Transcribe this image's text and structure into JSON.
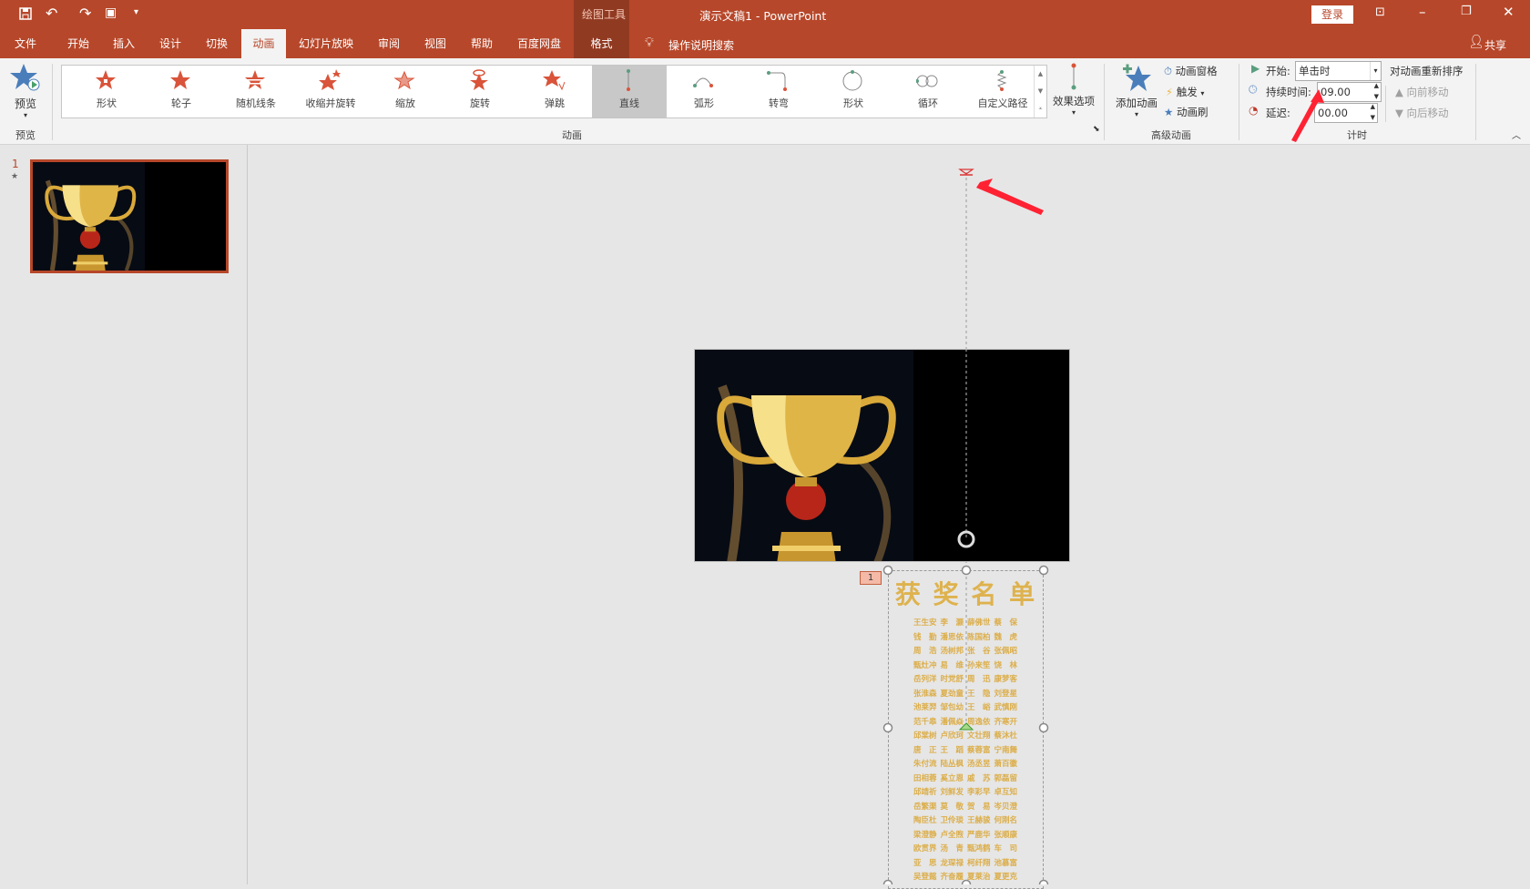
{
  "titlebar": {
    "title": "演示文稿1  -  PowerPoint",
    "context_tab": "绘图工具",
    "login": "登录"
  },
  "tabs": [
    "文件",
    "开始",
    "插入",
    "设计",
    "切换",
    "动画",
    "幻灯片放映",
    "审阅",
    "视图",
    "帮助",
    "百度网盘",
    "格式"
  ],
  "search": "操作说明搜索",
  "share": "共享",
  "ribbon": {
    "preview": "预览",
    "preview_group": "预览",
    "gallery": [
      "形状",
      "轮子",
      "随机线条",
      "收缩并旋转",
      "缩放",
      "旋转",
      "弹跳",
      "直线",
      "弧形",
      "转弯",
      "形状",
      "循环",
      "自定义路径"
    ],
    "anim_group": "动画",
    "effect_options": "效果选项",
    "add_animation": "添加动画",
    "anim_pane": "动画窗格",
    "trigger": "触发",
    "anim_painter": "动画刷",
    "advanced_group": "高级动画",
    "start_label": "开始:",
    "start_value": "单击时",
    "duration_label": "持续时间:",
    "duration_value": "09.00",
    "delay_label": "延迟:",
    "delay_value": "00.00",
    "timing_group": "计时",
    "reorder": "对动画重新排序",
    "move_earlier": "向前移动",
    "move_later": "向后移动"
  },
  "slides": {
    "number": "1",
    "anim_mark": "★"
  },
  "slide": {
    "anim_tag": "1",
    "heading": "获 奖 名 单",
    "names": [
      [
        "王生安",
        "李　灏",
        "薛佛世",
        "蔡　保"
      ],
      [
        "钱　勤",
        "潘思依",
        "陈国柏",
        "魏　虎"
      ],
      [
        "周　浩",
        "汤树邦",
        "张　谷",
        "张佩昭"
      ],
      [
        "甄灶冲",
        "易　维",
        "孙来笙",
        "饶　林"
      ],
      [
        "岳列洋",
        "时党舒",
        "周　迅",
        "康梦客"
      ],
      [
        "张淮森",
        "夏劲童",
        "王　隐",
        "刘登星"
      ],
      [
        "池莱羿",
        "邹包幼",
        "王　峪",
        "武慎刚"
      ],
      [
        "范千皋",
        "潘佩焱",
        "周逸依",
        "齐寒开"
      ],
      [
        "邱棠树",
        "卢欣珂",
        "文壮翔",
        "蔡沐杜"
      ],
      [
        "唐　正",
        "王　蹈",
        "蔡蓉富",
        "宁南舞"
      ],
      [
        "朱付流",
        "陆丛枫",
        "汤丞昱",
        "萧百徽"
      ],
      [
        "田相蓉",
        "奚立恩",
        "戚　苏",
        "郭磊留"
      ],
      [
        "邱靖祈",
        "刘鲜发",
        "李彩早",
        "卓互知"
      ],
      [
        "岳繁渠",
        "莫　敬",
        "贺　易",
        "岑贝澄"
      ],
      [
        "陶臣杜",
        "卫伶琰",
        "王赫骏",
        "何刚名"
      ],
      [
        "梁澄静",
        "卢全煦",
        "严鹿华",
        "张顺康"
      ],
      [
        "欧贯界",
        "汤　青",
        "甄鸿鹤",
        "车　司"
      ],
      [
        "亚　思",
        "龙琛禄",
        "柯纤翔",
        "池慕富"
      ],
      [
        "吴登懿",
        "齐奋履",
        "夏莱治",
        "夏更克"
      ]
    ]
  },
  "colors": {
    "accent": "#b7472a",
    "gold": "#dcae4a"
  }
}
